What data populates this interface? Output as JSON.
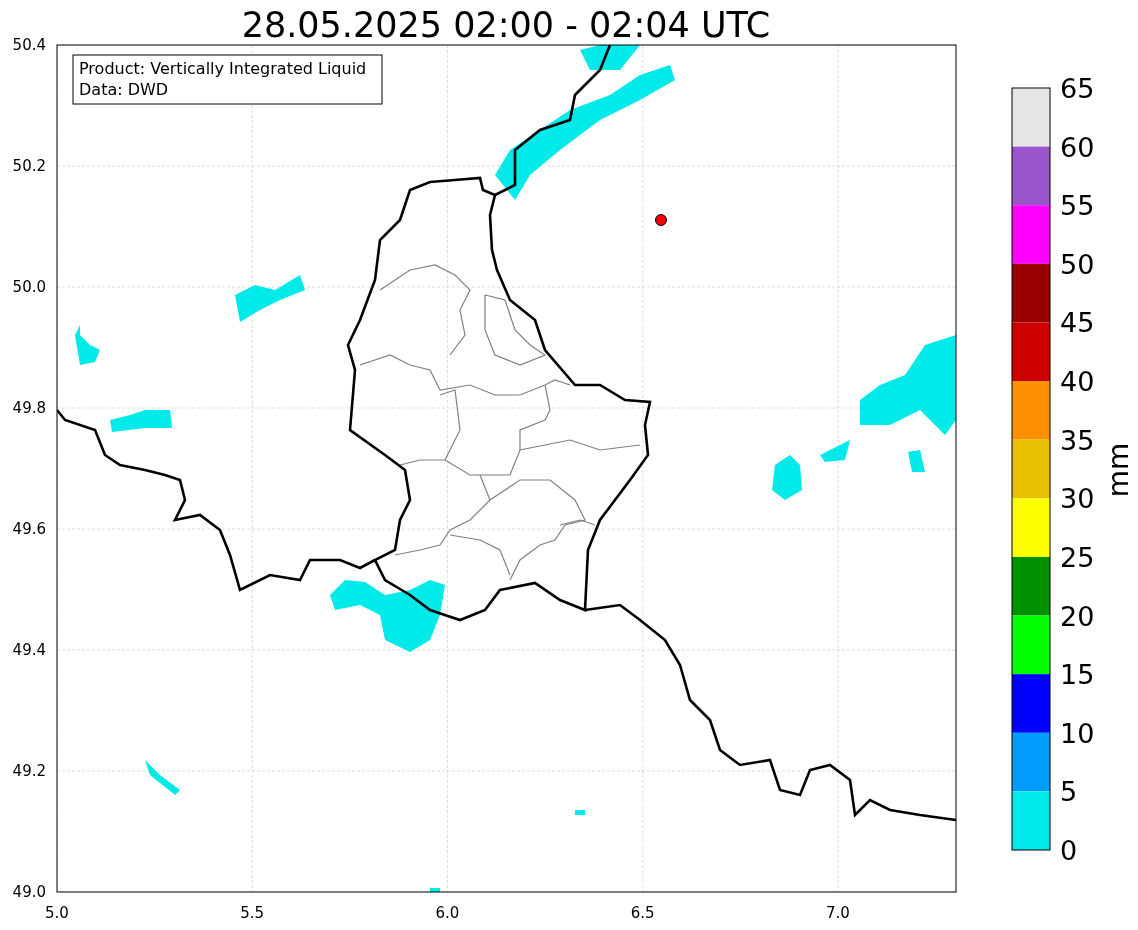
{
  "title": "28.05.2025 02:00 - 02:04 UTC",
  "info_box": {
    "lines": [
      "Product: Vertically Integrated Liquid",
      "Data: DWD"
    ]
  },
  "x_ticks": [
    "5.0",
    "5.5",
    "6.0",
    "6.5",
    "7.0"
  ],
  "y_ticks": [
    "50.4",
    "50.2",
    "50.0",
    "49.8",
    "49.6",
    "49.4",
    "49.2",
    "49.0"
  ],
  "colorbar": {
    "label": "mm",
    "segments": [
      {
        "color": "#e5e5e5"
      },
      {
        "color": "#9955c9"
      },
      {
        "color": "#ff00ff"
      },
      {
        "color": "#9a0000"
      },
      {
        "color": "#cc0000"
      },
      {
        "color": "#ff9000"
      },
      {
        "color": "#e7c000"
      },
      {
        "color": "#ffff00"
      },
      {
        "color": "#009000"
      },
      {
        "color": "#00ff00"
      },
      {
        "color": "#0000ff"
      },
      {
        "color": "#009dff"
      },
      {
        "color": "#00eaea"
      }
    ],
    "ticks": [
      "65",
      "60",
      "55",
      "50",
      "45",
      "40",
      "35",
      "30",
      "25",
      "20",
      "15",
      "10",
      "5",
      "0"
    ]
  }
}
